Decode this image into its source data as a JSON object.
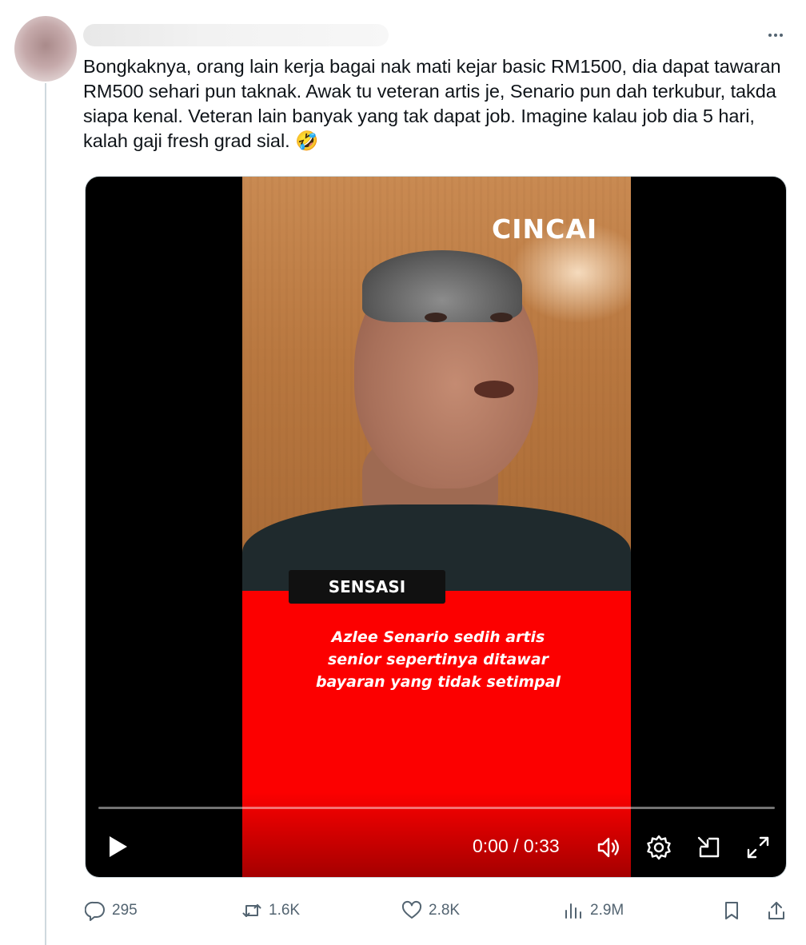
{
  "post": {
    "text": "Bongkaknya, orang lain kerja bagai nak mati kejar basic RM1500, dia dapat tawaran RM500 sehari pun taknak. Awak tu veteran artis je, Senario pun dah terkubur, takda siapa kenal. Veteran lain banyak yang tak dapat job. Imagine kalau job dia 5 hari, kalah gaji fresh grad sial.",
    "emoji": "🤣"
  },
  "video": {
    "brand": "CINCAI",
    "tag": "SENSASI",
    "headline_lines": [
      "Azlee Senario sedih artis",
      "senior sepertinya ditawar",
      "bayaran yang tidak setimpal"
    ],
    "time": "0:00 / 0:33",
    "progress": 0
  },
  "actions": {
    "replies": "295",
    "reposts": "1.6K",
    "likes": "2.8K",
    "views": "2.9M"
  },
  "colors": {
    "red_panel": "#fc0000",
    "icon_gray": "#536471",
    "text": "#0f1419"
  }
}
